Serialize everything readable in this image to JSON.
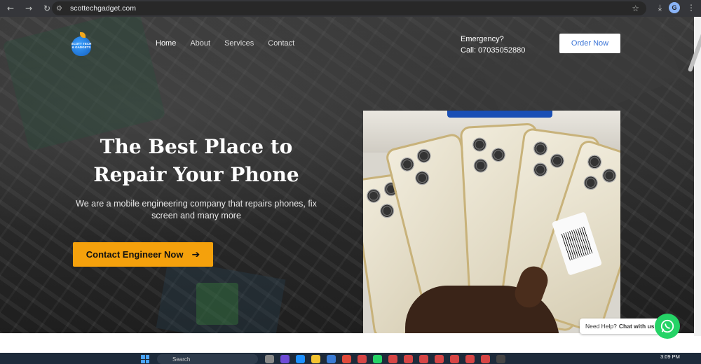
{
  "browser": {
    "url": "scottechgadget.com",
    "profile_initial": "G"
  },
  "logo": {
    "text": "SCOTT TECH & GADGETS"
  },
  "nav": {
    "items": [
      {
        "label": "Home"
      },
      {
        "label": "About"
      },
      {
        "label": "Services"
      },
      {
        "label": "Contact"
      }
    ]
  },
  "header": {
    "emergency_label": "Emergency?",
    "phone_label": "Call: 07035052880",
    "order_button": "Order Now"
  },
  "hero": {
    "title_line1": "The Best Place to",
    "title_line2": "Repair Your Phone",
    "subtitle_line1": "We are a mobile engineering company that repairs phones, fix",
    "subtitle_line2": "screen and many more",
    "cta_label": "Contact Engineer Now"
  },
  "whatsapp": {
    "prefix": "Need Help?",
    "bold": "Chat with us"
  },
  "taskbar": {
    "search_placeholder": "Search",
    "time": "3:09 PM"
  },
  "colors": {
    "accent": "#f5a10c",
    "order_text": "#3b74d6",
    "whatsapp": "#25d366"
  }
}
